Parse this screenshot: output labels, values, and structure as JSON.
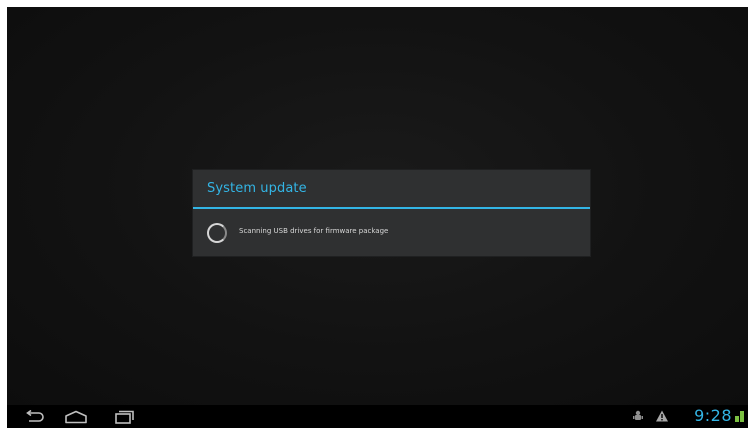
{
  "dialog": {
    "title": "System update",
    "message": "Scanning USB drives for firmware package"
  },
  "navbar": {
    "back_icon": "back-icon",
    "home_icon": "home-icon",
    "recents_icon": "recent-apps-icon"
  },
  "status": {
    "time": "9:28",
    "icons": [
      "usb-debugging-icon",
      "warning-icon",
      "signal-icon"
    ]
  },
  "colors": {
    "accent": "#33b5e5",
    "dialog_bg": "#2f3031",
    "screen_bg": "#121212"
  }
}
